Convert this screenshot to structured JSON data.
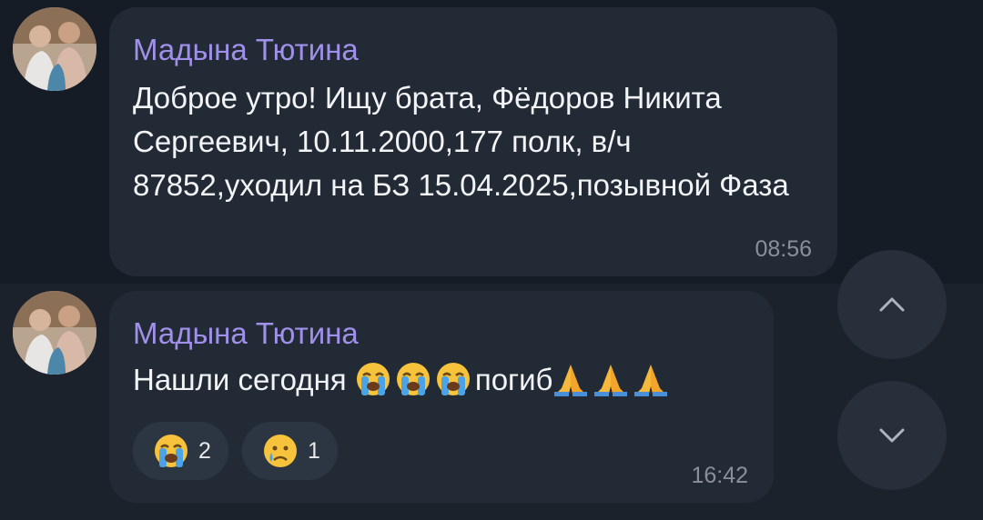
{
  "messages": [
    {
      "sender": "Мадына Тютина",
      "text": "Доброе утро! Ищу брата, Фёдоров Никита Сергеевич, 10.11.2000,177 полк, в/ч 87852,уходил на БЗ 15.04.2025,позывной Фаза",
      "time": "08:56"
    },
    {
      "sender": "Мадына Тютина",
      "text_main": "Нашли сегодня ",
      "text_word": "погиб",
      "inline_emojis": [
        "loudly-crying-face",
        "loudly-crying-face",
        "loudly-crying-face",
        "folded-hands",
        "folded-hands",
        "folded-hands"
      ],
      "reactions": [
        {
          "emoji": "loudly-crying-face",
          "count": "2"
        },
        {
          "emoji": "crying-face",
          "count": "1"
        }
      ],
      "time": "16:42"
    }
  ],
  "controls": {
    "scroll_up_icon": "chevron-up-icon",
    "scroll_down_icon": "chevron-down-icon"
  },
  "colors": {
    "background": "#161c25",
    "bubble": "#222a35",
    "sender_name": "#a190e9",
    "text": "#f2f4f6",
    "timestamp": "#8a9099"
  }
}
